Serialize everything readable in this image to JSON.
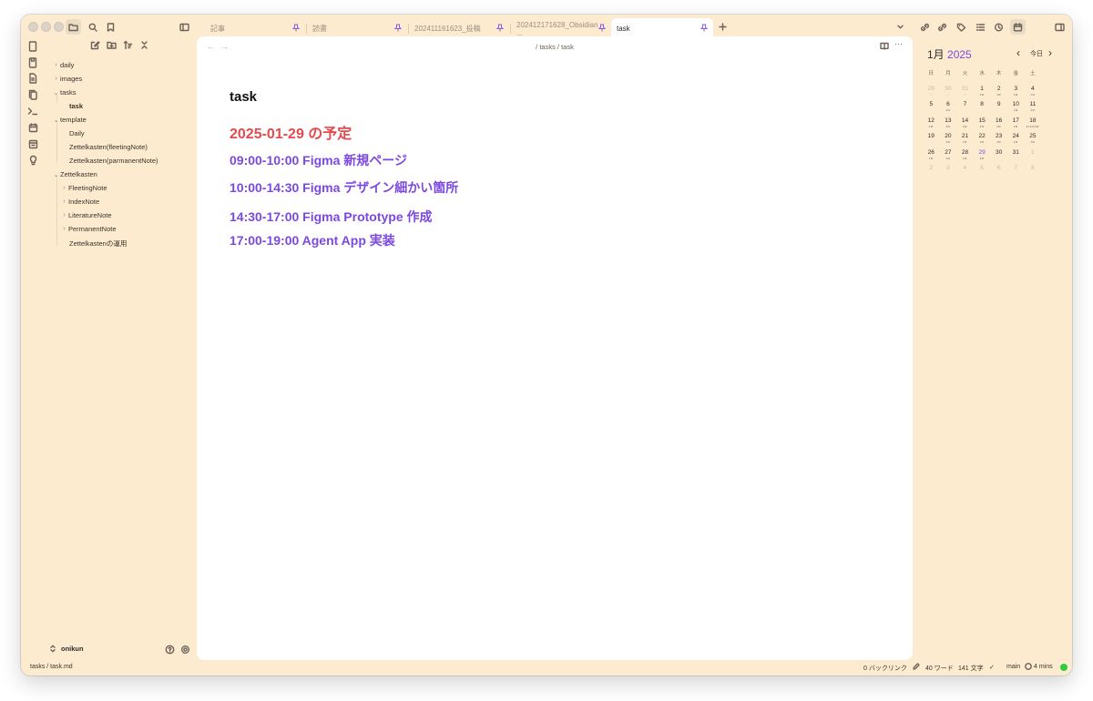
{
  "tabs": [
    {
      "label": "記事",
      "active": false
    },
    {
      "label": "読書",
      "active": false
    },
    {
      "label": "202411161623_投稿",
      "active": false
    },
    {
      "label": "202412171628_Obsidian ...",
      "active": false
    },
    {
      "label": "task",
      "active": true
    }
  ],
  "file_tree": [
    {
      "label": "daily",
      "expanded": false,
      "depth": 0
    },
    {
      "label": "images",
      "expanded": false,
      "depth": 0
    },
    {
      "label": "tasks",
      "expanded": true,
      "depth": 0
    },
    {
      "label": "task",
      "depth": 1,
      "selected": true
    },
    {
      "label": "template",
      "expanded": true,
      "depth": 0
    },
    {
      "label": "Daily",
      "depth": 1
    },
    {
      "label": "Zettelkasten(fleetingNote)",
      "depth": 1
    },
    {
      "label": "Zettelkasten(parmanentNote)",
      "depth": 1
    },
    {
      "label": "Zettelkasten",
      "expanded": true,
      "depth": 0
    },
    {
      "label": "FleetingNote",
      "expanded": false,
      "depth": 1
    },
    {
      "label": "IndexNote",
      "expanded": false,
      "depth": 1
    },
    {
      "label": "LiteratureNote",
      "expanded": false,
      "depth": 1
    },
    {
      "label": "PermanentNote",
      "expanded": false,
      "depth": 1
    },
    {
      "label": "Zettelkastenの運用",
      "depth": 1
    }
  ],
  "editor": {
    "breadcrumb": "/ tasks / task",
    "title": "task",
    "heading": "2025-01-29 の予定",
    "items": [
      "09:00-10:00 Figma 新規ページ",
      "10:00-14:30 Figma デザイン細かい箇所",
      "14:30-17:00 Figma Prototype 作成",
      "17:00-19:00 Agent App 実装"
    ]
  },
  "calendar": {
    "month": "1月",
    "year": "2025",
    "today_label": "今日",
    "weekdays": [
      "日",
      "月",
      "火",
      "水",
      "木",
      "金",
      "土"
    ],
    "weeks": [
      [
        {
          "d": "29",
          "m": true,
          "dots": "••"
        },
        {
          "d": "30",
          "m": true,
          "dots": "••"
        },
        {
          "d": "31",
          "m": true,
          "dots": "••"
        },
        {
          "d": "1",
          "dots": "•o"
        },
        {
          "d": "2",
          "dots": "•o"
        },
        {
          "d": "3",
          "dots": "•o"
        },
        {
          "d": "4",
          "dots": "•o"
        }
      ],
      [
        {
          "d": "5",
          "dots": ""
        },
        {
          "d": "6",
          "dots": "•o"
        },
        {
          "d": "7",
          "dots": ""
        },
        {
          "d": "8",
          "dots": ""
        },
        {
          "d": "9",
          "dots": ""
        },
        {
          "d": "10",
          "dots": "•o"
        },
        {
          "d": "11",
          "dots": "•o"
        }
      ],
      [
        {
          "d": "12",
          "dots": "•o"
        },
        {
          "d": "13",
          "dots": "•o"
        },
        {
          "d": "14",
          "dots": "•o"
        },
        {
          "d": "15",
          "dots": "•o"
        },
        {
          "d": "16",
          "dots": "•o"
        },
        {
          "d": "17",
          "dots": "•o"
        },
        {
          "d": "18",
          "dots": "••••••o"
        }
      ],
      [
        {
          "d": "19",
          "dots": ""
        },
        {
          "d": "20",
          "dots": "•o"
        },
        {
          "d": "21",
          "dots": "•o"
        },
        {
          "d": "22",
          "dots": "•o"
        },
        {
          "d": "23",
          "dots": "•o"
        },
        {
          "d": "24",
          "dots": "•o"
        },
        {
          "d": "25",
          "dots": "•o"
        }
      ],
      [
        {
          "d": "26",
          "dots": "•o"
        },
        {
          "d": "27",
          "dots": "•o"
        },
        {
          "d": "28",
          "dots": "•o"
        },
        {
          "d": "29",
          "sel": true,
          "dots": "•o"
        },
        {
          "d": "30",
          "dots": ""
        },
        {
          "d": "31",
          "dots": ""
        },
        {
          "d": "1",
          "m": true,
          "dots": ""
        }
      ],
      [
        {
          "d": "2",
          "m": true,
          "dots": ""
        },
        {
          "d": "3",
          "m": true,
          "dots": ""
        },
        {
          "d": "4",
          "m": true,
          "dots": ""
        },
        {
          "d": "5",
          "m": true,
          "dots": ""
        },
        {
          "d": "6",
          "m": true,
          "dots": ""
        },
        {
          "d": "7",
          "m": true,
          "dots": ""
        },
        {
          "d": "8",
          "m": true,
          "dots": ""
        }
      ]
    ]
  },
  "vault": {
    "name": "onikun"
  },
  "status": {
    "path": "tasks / task.md",
    "backlinks": "0 バックリンク",
    "words": "40 ワード",
    "chars": "141 文字",
    "branch": "main",
    "sync": "4 mins"
  },
  "colors": {
    "background": "#fdebd0",
    "heading_red": "#e5494d",
    "heading_purple": "#7b49e0",
    "sync_dot": "#2ecc40"
  }
}
